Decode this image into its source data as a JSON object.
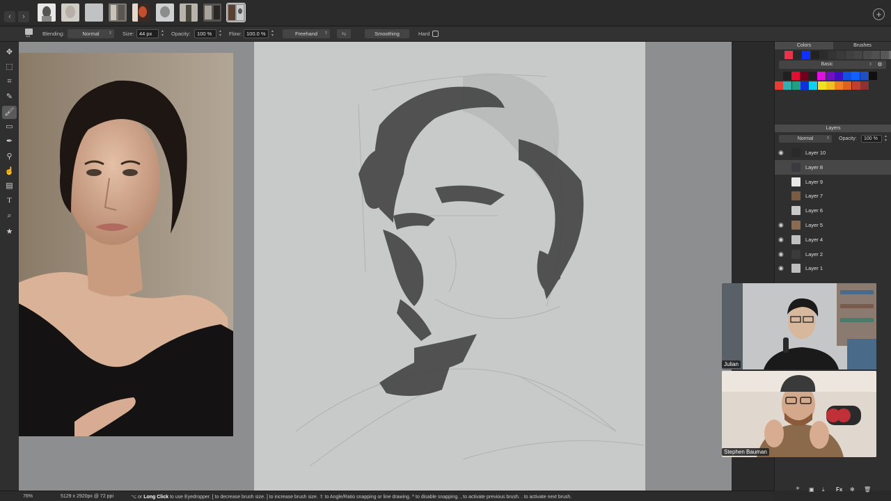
{
  "thumbnails": [
    "doc-1",
    "doc-2",
    "doc-3",
    "doc-4",
    "doc-5",
    "doc-6",
    "doc-7",
    "doc-8",
    "doc-9"
  ],
  "options": {
    "brush_size_badge": "44",
    "blending_label": "Blending:",
    "blending_value": "Normal",
    "size_label": "Size:",
    "size_value": "44 px",
    "opacity_label": "Opacity:",
    "opacity_value": "100 %",
    "flow_label": "Flow:",
    "flow_value": "100.0 %",
    "mode_value": "Freehand",
    "smoothing_label": "Smoothing",
    "hard_label": "Hard"
  },
  "colors_panel": {
    "tab_colors": "Colors",
    "tab_brushes": "Brushes",
    "palette_name": "Basic",
    "recent_colors": [
      "#e8334a",
      "#2a2a2a",
      "#1030ff",
      "#222222",
      "#2c2c2c",
      "#343434",
      "#3a3a3a",
      "#404040",
      "#454545",
      "#4a4a4a",
      "#505050",
      "#585858",
      "#6e6e6e"
    ],
    "swatches_row1": [
      "#202020",
      "#e01030",
      "#700020",
      "#202020",
      "#e010e0",
      "#7010c0",
      "#4010c0",
      "#1050e0",
      "#1060ff",
      "#2050c0",
      "#101010"
    ],
    "swatches_row2": [
      "#e83c30",
      "#30b0b0",
      "#20a080",
      "#1030e0",
      "#10d0f0",
      "#f0e020",
      "#f0c020",
      "#f08020",
      "#e06020",
      "#c04030",
      "#903030"
    ]
  },
  "layers_panel": {
    "title": "Layers",
    "blend_mode": "Normal",
    "opacity_label": "Opacity:",
    "opacity_value": "100 %",
    "layers": [
      {
        "name": "Layer 10",
        "visible": true
      },
      {
        "name": "Layer 8",
        "visible": false,
        "selected": true
      },
      {
        "name": "Layer 9",
        "visible": false
      },
      {
        "name": "Layer 7",
        "visible": false
      },
      {
        "name": "Layer 6",
        "visible": false
      },
      {
        "name": "Layer 5",
        "visible": true
      },
      {
        "name": "Layer 4",
        "visible": true
      },
      {
        "name": "Layer 2",
        "visible": true
      },
      {
        "name": "Layer 1",
        "visible": true
      }
    ]
  },
  "status": {
    "zoom": "76%",
    "doc_info": "5129 x 2920px @ 72 ppi",
    "hint_prefix": "⌥ or",
    "hint_bold": "Long Click",
    "hint_rest": "to use Eyedropper.  [ to decrease brush size.  ] to increase brush size.  ⇧ to Angle/Ratio snapping or line drawing.  ^ to disable snapping.  , to activate previous brush.  . to activate next brush."
  },
  "call": {
    "participant1": "Julian",
    "participant2": "Stephen Bauman"
  },
  "icons": {
    "back": "‹",
    "forward": "›",
    "add": "+",
    "eye": "👁"
  }
}
